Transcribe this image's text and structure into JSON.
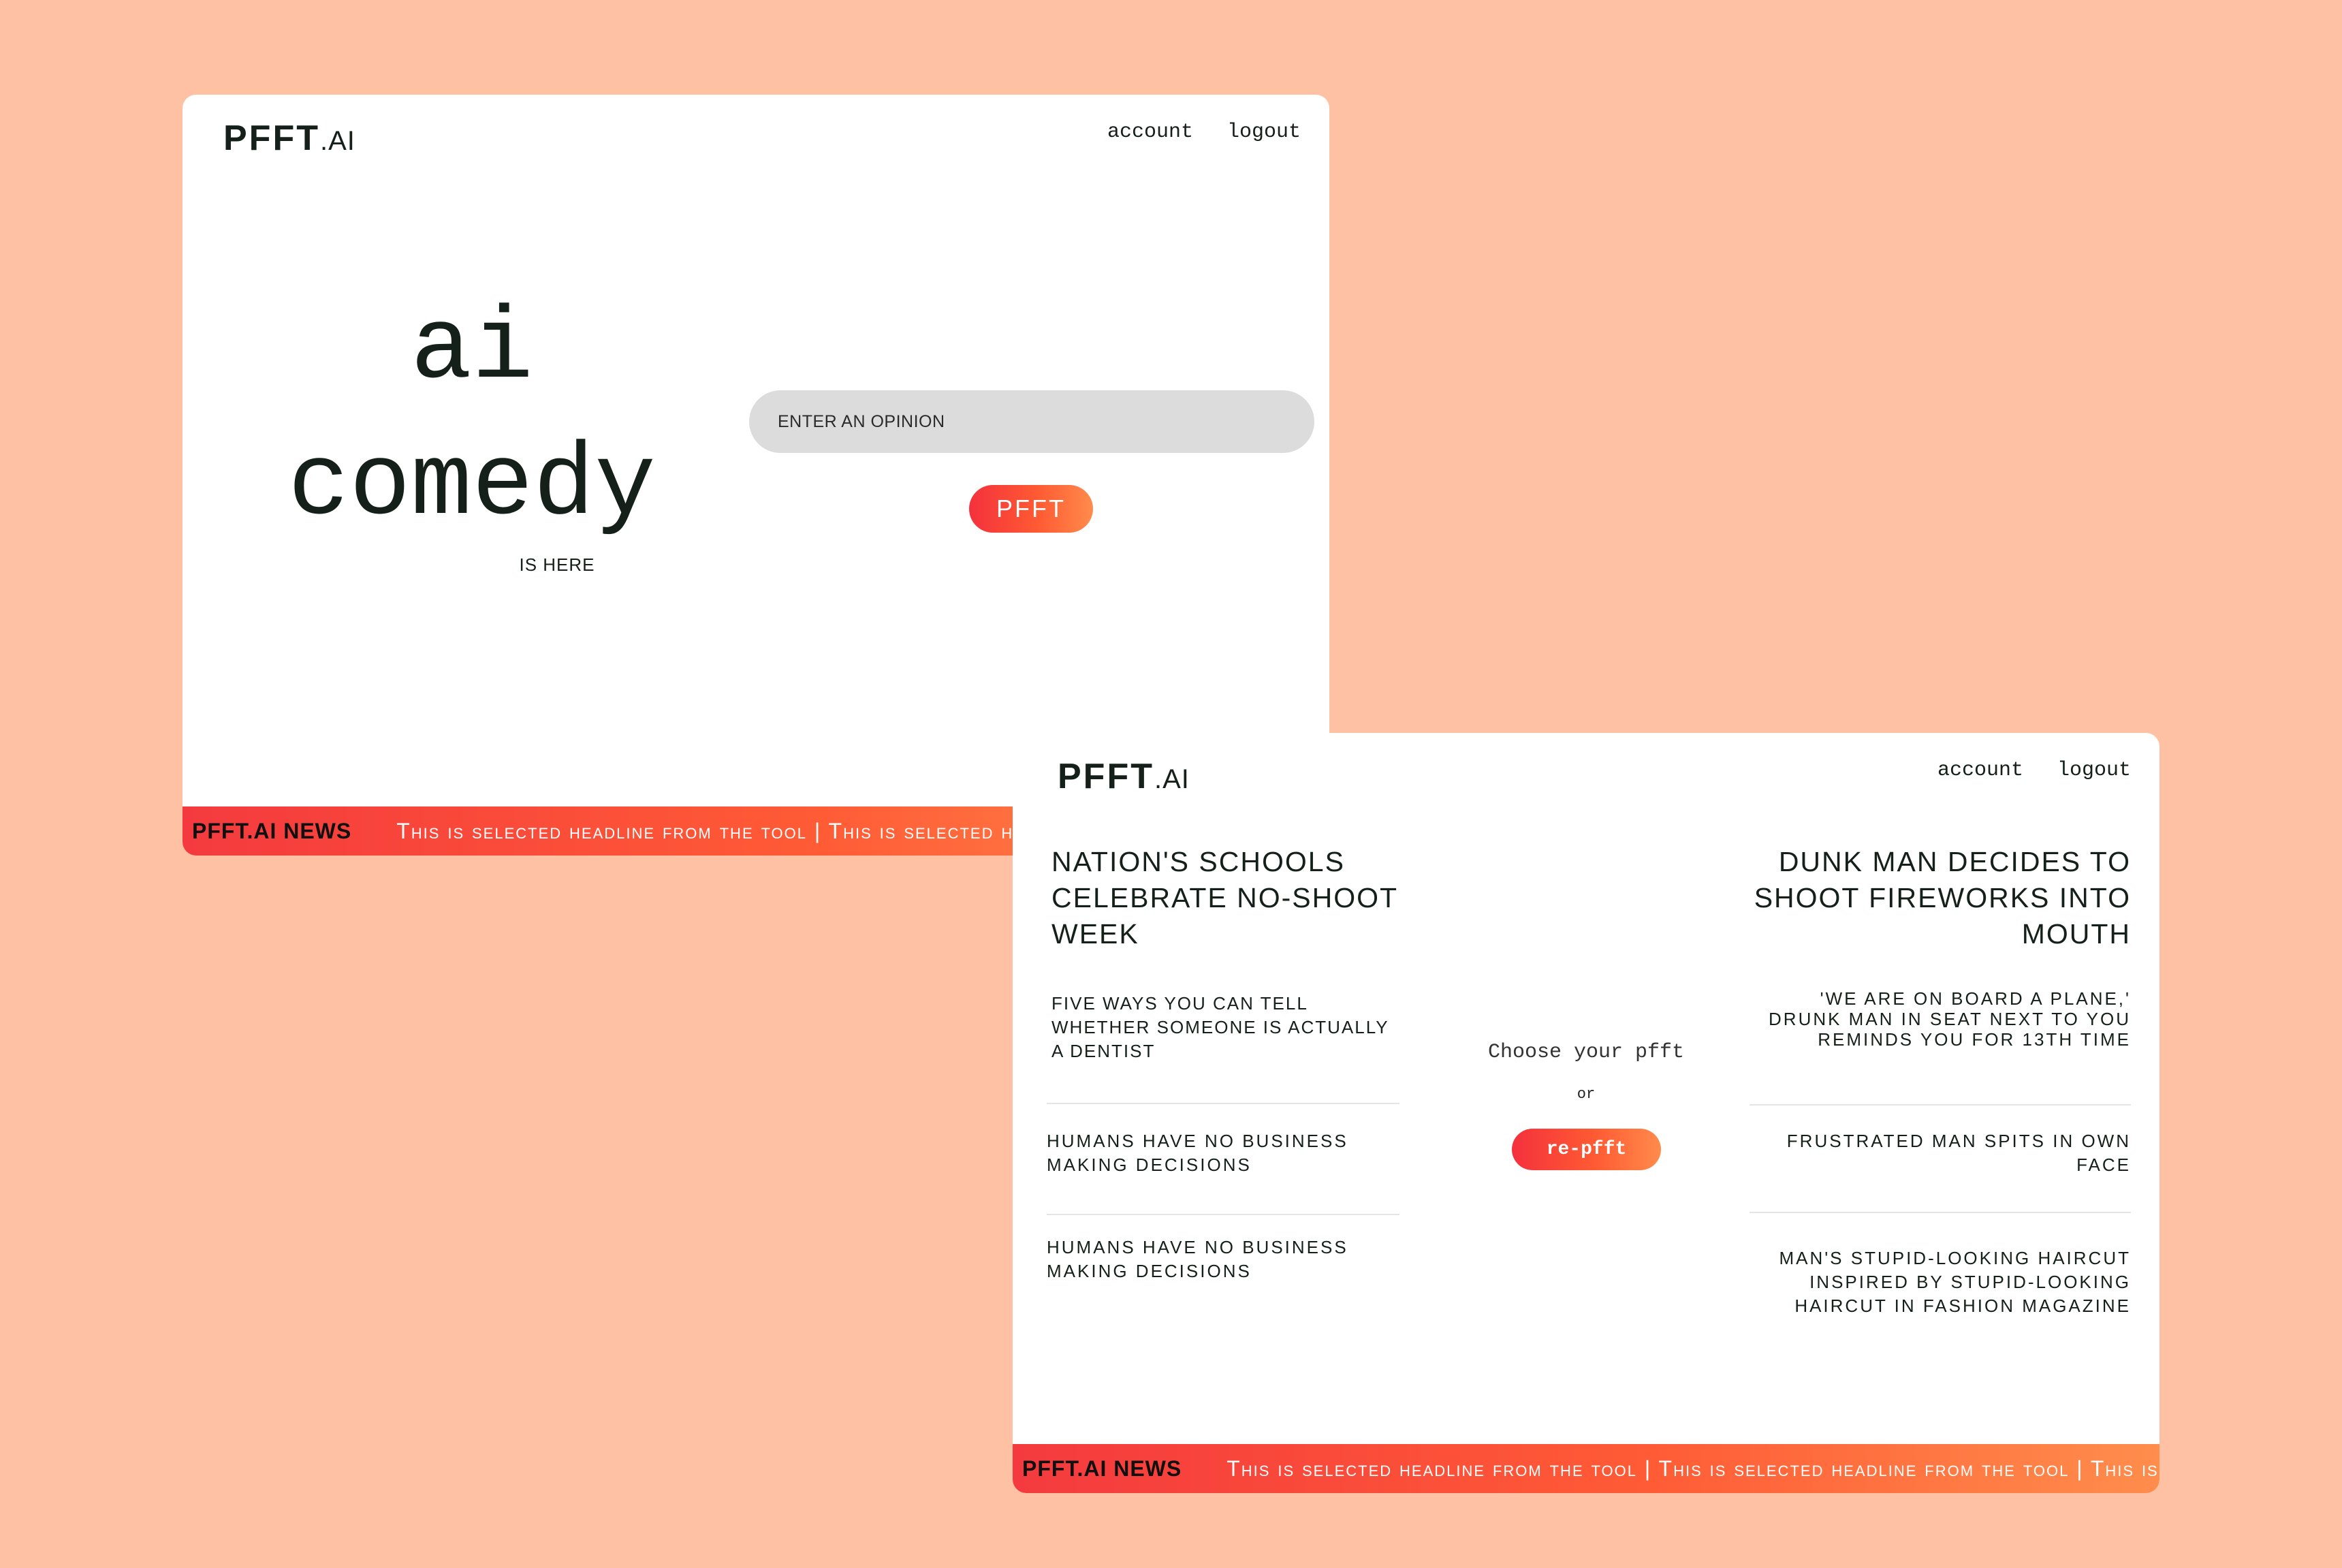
{
  "brand": {
    "name": "PFFT",
    "suffix": ".AI"
  },
  "nav": {
    "account": "account",
    "logout": "logout"
  },
  "home": {
    "hero_line1": "ai",
    "hero_line2": "comedy",
    "hero_sub": "IS HERE",
    "input_placeholder": "ENTER AN OPINION",
    "button": "PFFT"
  },
  "ticker": {
    "tag": "PFFT.AI NEWS",
    "text": "This is selected headline from the tool | This is selected headline from the tool | This is selected headline from the tool"
  },
  "results": {
    "left": {
      "main": "NATION'S SCHOOLS CELEBRATE NO-SHOOT WEEK",
      "items": [
        "FIVE WAYS YOU CAN TELL WHETHER SOMEONE IS ACTUALLY A DENTIST",
        "HUMANS HAVE NO BUSINESS MAKING DECISIONS",
        "HUMANS HAVE NO BUSINESS MAKING DECISIONS"
      ]
    },
    "right": {
      "main": "DUNK MAN DECIDES TO SHOOT FIREWORKS INTO MOUTH",
      "items": [
        "'WE ARE ON BOARD A PLANE,' DRUNK MAN IN SEAT NEXT TO YOU REMINDS YOU FOR 13TH TIME",
        "FRUSTRATED MAN SPITS IN OWN FACE",
        "MAN'S STUPID-LOOKING HAIRCUT INSPIRED BY STUPID-LOOKING HAIRCUT IN FASHION MAGAZINE"
      ]
    },
    "choose": "Choose your pfft",
    "or": "or",
    "repfft": "re-pfft"
  },
  "colors": {
    "background": "#FFC1A4",
    "accent_start": "#F4313D",
    "accent_end": "#FF8B4B",
    "input_bg": "#DCDCDC",
    "text": "#142019"
  }
}
